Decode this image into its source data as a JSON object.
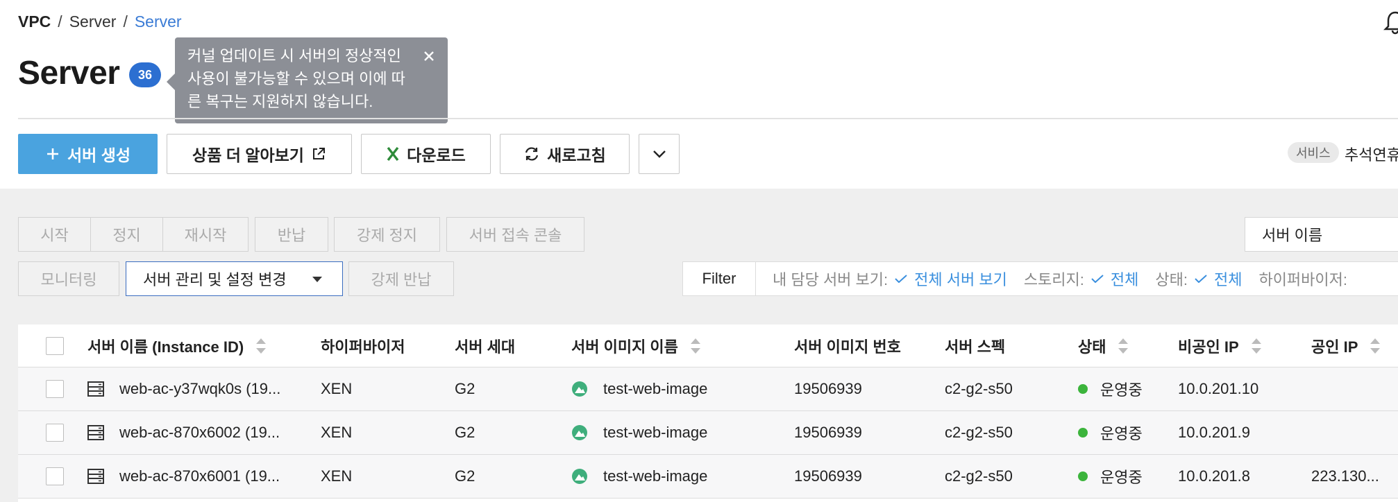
{
  "breadcrumb": {
    "root": "VPC",
    "sep": "/",
    "middle": "Server",
    "current": "Server"
  },
  "page": {
    "title": "Server",
    "count": "36"
  },
  "tooltip": {
    "text": "커널 업데이트 시 서버의 정상적인 사용이 불가능할 수 있으며 이에 따른 복구는 지원하지 않습니다."
  },
  "toolbar": {
    "create": "서버 생성",
    "learn_more": "상품 더 알아보기",
    "download": "다운로드",
    "refresh": "새로고침"
  },
  "service": {
    "tag": "서비스",
    "name": "추석연휴"
  },
  "actions": {
    "start": "시작",
    "stop": "정지",
    "restart": "재시작",
    "return": "반납",
    "force_stop": "강제 정지",
    "console": "서버 접속 콘솔",
    "monitoring": "모니터링",
    "manage": "서버 관리 및 설정 변경",
    "force_return": "강제 반납"
  },
  "search": {
    "field": "서버 이름"
  },
  "filter": {
    "label": "Filter",
    "my_server_key": "내 담당 서버 보기:",
    "my_server_val": "전체 서버 보기",
    "storage_key": "스토리지:",
    "storage_val": "전체",
    "status_key": "상태:",
    "status_val": "전체",
    "hypervisor_key": "하이퍼바이저:"
  },
  "table": {
    "headers": {
      "name": "서버 이름 (Instance ID)",
      "hypervisor": "하이퍼바이저",
      "generation": "서버 세대",
      "image_name": "서버 이미지 이름",
      "image_no": "서버 이미지 번호",
      "spec": "서버 스펙",
      "status": "상태",
      "private_ip": "비공인 IP",
      "public_ip": "공인 IP"
    },
    "rows": [
      {
        "name": "web-ac-y37wqk0s (19...",
        "hypervisor": "XEN",
        "generation": "G2",
        "image_name": "test-web-image",
        "image_no": "19506939",
        "spec": "c2-g2-s50",
        "status": "운영중",
        "private_ip": "10.0.201.10",
        "public_ip": ""
      },
      {
        "name": "web-ac-870x6002 (19...",
        "hypervisor": "XEN",
        "generation": "G2",
        "image_name": "test-web-image",
        "image_no": "19506939",
        "spec": "c2-g2-s50",
        "status": "운영중",
        "private_ip": "10.0.201.9",
        "public_ip": ""
      },
      {
        "name": "web-ac-870x6001 (19...",
        "hypervisor": "XEN",
        "generation": "G2",
        "image_name": "test-web-image",
        "image_no": "19506939",
        "spec": "c2-g2-s50",
        "status": "운영중",
        "private_ip": "10.0.201.8",
        "public_ip": "223.130..."
      }
    ]
  },
  "colors": {
    "primary": "#4aa3df",
    "badge": "#2c6fd1",
    "link": "#3a8fde",
    "status_ok": "#3cb43c",
    "tooltip": "#8c8f96"
  }
}
